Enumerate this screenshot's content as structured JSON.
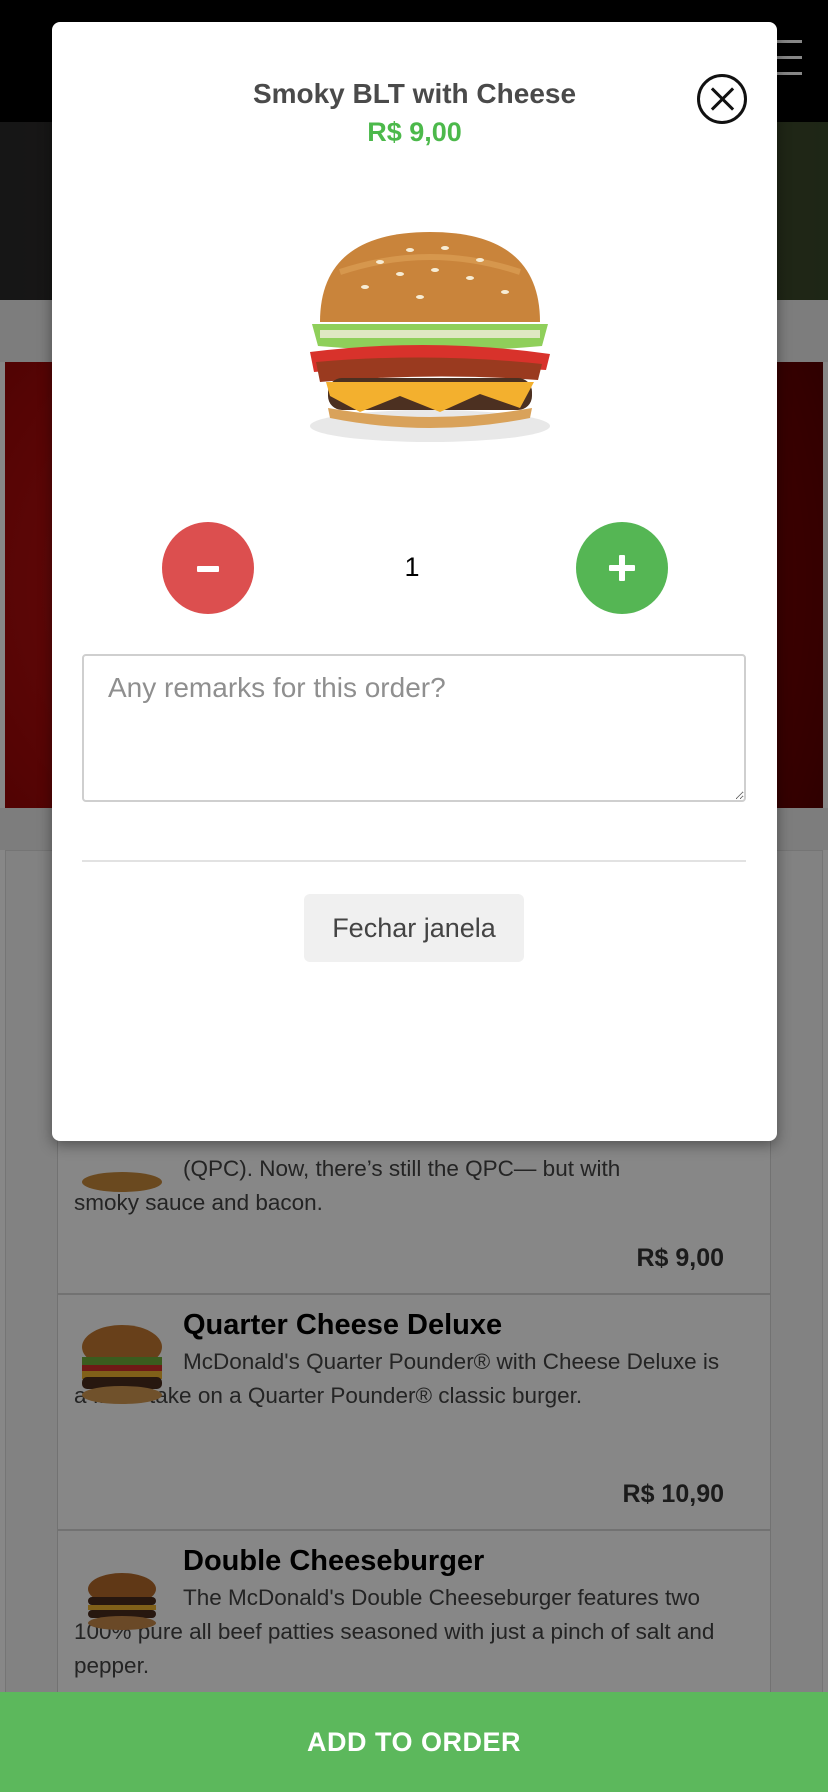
{
  "modal": {
    "title": "Smoky BLT with Cheese",
    "price": "R$ 9,00",
    "quantity": "1",
    "remarks_placeholder": "Any remarks for this order?",
    "close_window_label": "Fechar janela",
    "icons": {
      "close": "close-x-icon",
      "minus": "minus-icon",
      "plus": "plus-icon"
    }
  },
  "menu_items": [
    {
      "desc_line1": "(QPC). Now, there’s still the QPC— but with",
      "desc_line2": "smoky sauce and bacon.",
      "price": "R$ 9,00"
    },
    {
      "name": "Quarter Cheese Deluxe",
      "description": "McDonald's Quarter Pounder® with Cheese Deluxe is a fresh take on a Quarter Pounder® classic burger.",
      "price": "R$ 10,90"
    },
    {
      "name": "Double Cheeseburger",
      "description": "The McDonald's Double Cheeseburger features two 100% pure all beef patties seasoned with just a pinch of salt and pepper."
    }
  ],
  "add_to_order_label": "ADD TO ORDER",
  "colors": {
    "price_green": "#4cb94b",
    "minus_red": "#dc4f4f",
    "plus_green": "#55b654",
    "add_bar_green": "#5cb85c"
  }
}
